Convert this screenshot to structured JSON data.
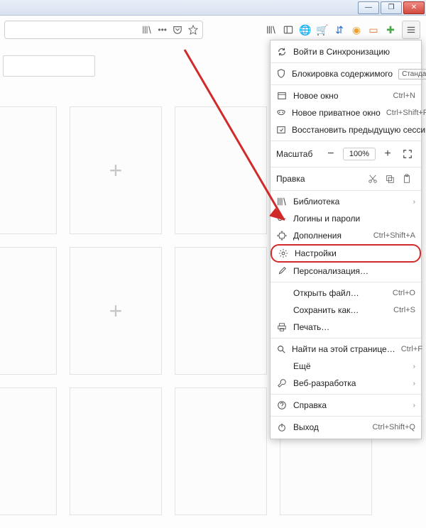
{
  "titlebar": {
    "min": "—",
    "max": "❐",
    "close": "✕"
  },
  "addrbar": {
    "ellipsis": "•••"
  },
  "ext": {
    "library": "|||\\",
    "reader": "⧉",
    "globe": "🌐",
    "cart": "🛒",
    "updown": "⇵",
    "circle": "◉",
    "square": "▭",
    "plus": "✚"
  },
  "tiles": {
    "plus": "+"
  },
  "menu": {
    "sync": "Войти в Синхронизацию",
    "block": "Блокировка содержимого",
    "block_state": "Стандартная",
    "newwin": "Новое окно",
    "newwin_sc": "Ctrl+N",
    "private": "Новое приватное окно",
    "private_sc": "Ctrl+Shift+P",
    "restore": "Восстановить предыдущую сессию",
    "zoom": "Масштаб",
    "zoom_val": "100%",
    "edit": "Правка",
    "library": "Библиотека",
    "logins": "Логины и пароли",
    "addons": "Дополнения",
    "addons_sc": "Ctrl+Shift+A",
    "settings": "Настройки",
    "customize": "Персонализация…",
    "open": "Открыть файл…",
    "open_sc": "Ctrl+O",
    "save": "Сохранить как…",
    "save_sc": "Ctrl+S",
    "print": "Печать…",
    "find": "Найти на этой странице…",
    "find_sc": "Ctrl+F",
    "more": "Ещё",
    "webdev": "Веб-разработка",
    "help": "Справка",
    "exit": "Выход",
    "exit_sc": "Ctrl+Shift+Q"
  }
}
